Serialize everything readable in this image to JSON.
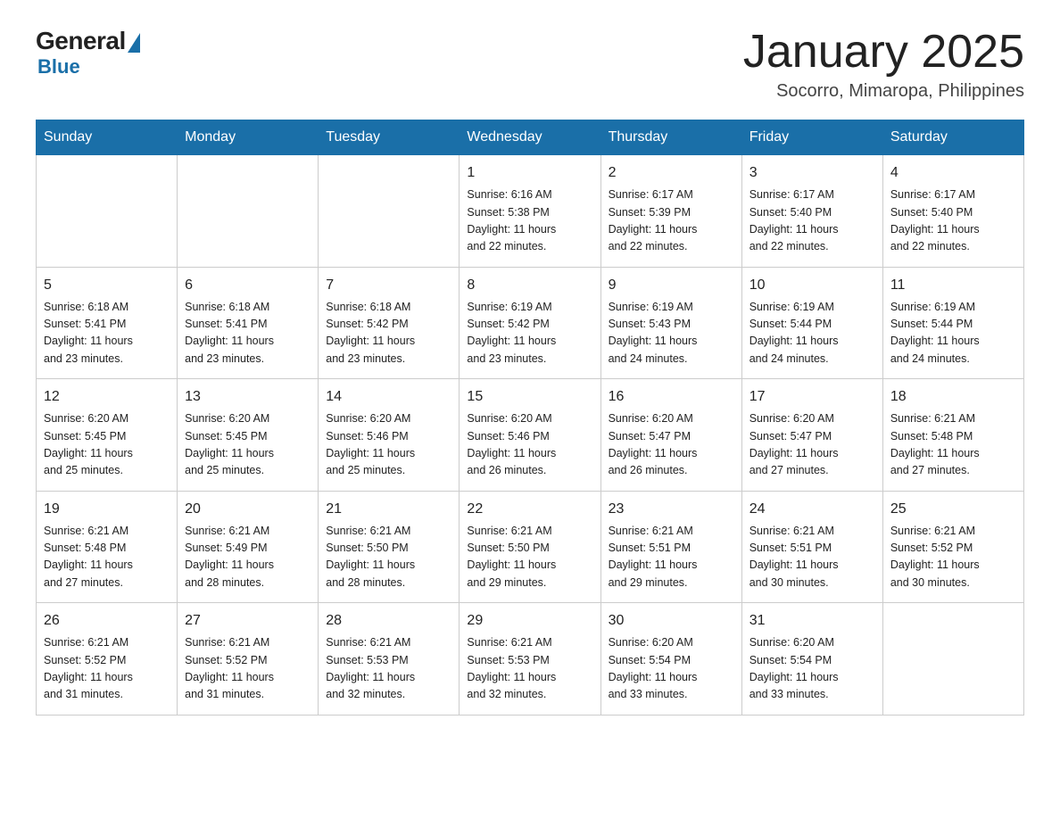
{
  "logo": {
    "general": "General",
    "blue": "Blue"
  },
  "header": {
    "month": "January 2025",
    "location": "Socorro, Mimaropa, Philippines"
  },
  "days_header": [
    "Sunday",
    "Monday",
    "Tuesday",
    "Wednesday",
    "Thursday",
    "Friday",
    "Saturday"
  ],
  "weeks": [
    [
      {
        "num": "",
        "info": ""
      },
      {
        "num": "",
        "info": ""
      },
      {
        "num": "",
        "info": ""
      },
      {
        "num": "1",
        "info": "Sunrise: 6:16 AM\nSunset: 5:38 PM\nDaylight: 11 hours\nand 22 minutes."
      },
      {
        "num": "2",
        "info": "Sunrise: 6:17 AM\nSunset: 5:39 PM\nDaylight: 11 hours\nand 22 minutes."
      },
      {
        "num": "3",
        "info": "Sunrise: 6:17 AM\nSunset: 5:40 PM\nDaylight: 11 hours\nand 22 minutes."
      },
      {
        "num": "4",
        "info": "Sunrise: 6:17 AM\nSunset: 5:40 PM\nDaylight: 11 hours\nand 22 minutes."
      }
    ],
    [
      {
        "num": "5",
        "info": "Sunrise: 6:18 AM\nSunset: 5:41 PM\nDaylight: 11 hours\nand 23 minutes."
      },
      {
        "num": "6",
        "info": "Sunrise: 6:18 AM\nSunset: 5:41 PM\nDaylight: 11 hours\nand 23 minutes."
      },
      {
        "num": "7",
        "info": "Sunrise: 6:18 AM\nSunset: 5:42 PM\nDaylight: 11 hours\nand 23 minutes."
      },
      {
        "num": "8",
        "info": "Sunrise: 6:19 AM\nSunset: 5:42 PM\nDaylight: 11 hours\nand 23 minutes."
      },
      {
        "num": "9",
        "info": "Sunrise: 6:19 AM\nSunset: 5:43 PM\nDaylight: 11 hours\nand 24 minutes."
      },
      {
        "num": "10",
        "info": "Sunrise: 6:19 AM\nSunset: 5:44 PM\nDaylight: 11 hours\nand 24 minutes."
      },
      {
        "num": "11",
        "info": "Sunrise: 6:19 AM\nSunset: 5:44 PM\nDaylight: 11 hours\nand 24 minutes."
      }
    ],
    [
      {
        "num": "12",
        "info": "Sunrise: 6:20 AM\nSunset: 5:45 PM\nDaylight: 11 hours\nand 25 minutes."
      },
      {
        "num": "13",
        "info": "Sunrise: 6:20 AM\nSunset: 5:45 PM\nDaylight: 11 hours\nand 25 minutes."
      },
      {
        "num": "14",
        "info": "Sunrise: 6:20 AM\nSunset: 5:46 PM\nDaylight: 11 hours\nand 25 minutes."
      },
      {
        "num": "15",
        "info": "Sunrise: 6:20 AM\nSunset: 5:46 PM\nDaylight: 11 hours\nand 26 minutes."
      },
      {
        "num": "16",
        "info": "Sunrise: 6:20 AM\nSunset: 5:47 PM\nDaylight: 11 hours\nand 26 minutes."
      },
      {
        "num": "17",
        "info": "Sunrise: 6:20 AM\nSunset: 5:47 PM\nDaylight: 11 hours\nand 27 minutes."
      },
      {
        "num": "18",
        "info": "Sunrise: 6:21 AM\nSunset: 5:48 PM\nDaylight: 11 hours\nand 27 minutes."
      }
    ],
    [
      {
        "num": "19",
        "info": "Sunrise: 6:21 AM\nSunset: 5:48 PM\nDaylight: 11 hours\nand 27 minutes."
      },
      {
        "num": "20",
        "info": "Sunrise: 6:21 AM\nSunset: 5:49 PM\nDaylight: 11 hours\nand 28 minutes."
      },
      {
        "num": "21",
        "info": "Sunrise: 6:21 AM\nSunset: 5:50 PM\nDaylight: 11 hours\nand 28 minutes."
      },
      {
        "num": "22",
        "info": "Sunrise: 6:21 AM\nSunset: 5:50 PM\nDaylight: 11 hours\nand 29 minutes."
      },
      {
        "num": "23",
        "info": "Sunrise: 6:21 AM\nSunset: 5:51 PM\nDaylight: 11 hours\nand 29 minutes."
      },
      {
        "num": "24",
        "info": "Sunrise: 6:21 AM\nSunset: 5:51 PM\nDaylight: 11 hours\nand 30 minutes."
      },
      {
        "num": "25",
        "info": "Sunrise: 6:21 AM\nSunset: 5:52 PM\nDaylight: 11 hours\nand 30 minutes."
      }
    ],
    [
      {
        "num": "26",
        "info": "Sunrise: 6:21 AM\nSunset: 5:52 PM\nDaylight: 11 hours\nand 31 minutes."
      },
      {
        "num": "27",
        "info": "Sunrise: 6:21 AM\nSunset: 5:52 PM\nDaylight: 11 hours\nand 31 minutes."
      },
      {
        "num": "28",
        "info": "Sunrise: 6:21 AM\nSunset: 5:53 PM\nDaylight: 11 hours\nand 32 minutes."
      },
      {
        "num": "29",
        "info": "Sunrise: 6:21 AM\nSunset: 5:53 PM\nDaylight: 11 hours\nand 32 minutes."
      },
      {
        "num": "30",
        "info": "Sunrise: 6:20 AM\nSunset: 5:54 PM\nDaylight: 11 hours\nand 33 minutes."
      },
      {
        "num": "31",
        "info": "Sunrise: 6:20 AM\nSunset: 5:54 PM\nDaylight: 11 hours\nand 33 minutes."
      },
      {
        "num": "",
        "info": ""
      }
    ]
  ]
}
